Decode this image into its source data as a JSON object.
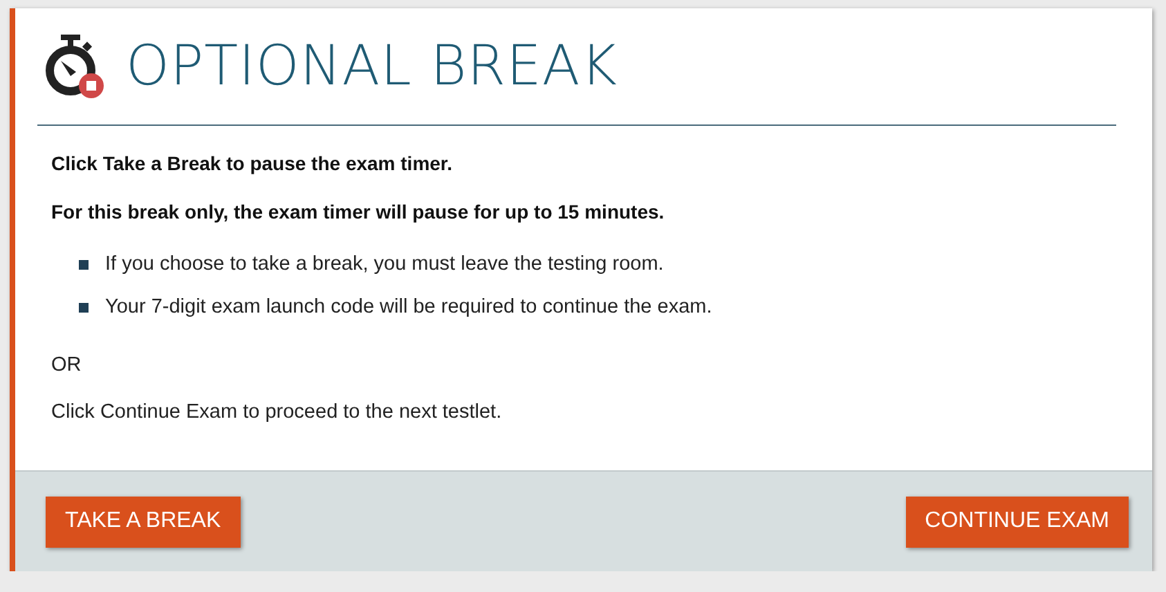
{
  "dialog": {
    "title": "OPTIONAL BREAK",
    "instructions": [
      "Click Take a Break to pause the exam timer.",
      "For this break only, the exam timer will pause for up to 15 minutes."
    ],
    "bullets": [
      "If you choose to take a break, you must leave the testing room.",
      "Your 7-digit exam launch code will be required to continue the exam."
    ],
    "separator": "OR",
    "note": "Click Continue Exam to proceed to the next testlet.",
    "buttons": [
      "TAKE A BREAK",
      "CONTINUE EXAM"
    ]
  }
}
